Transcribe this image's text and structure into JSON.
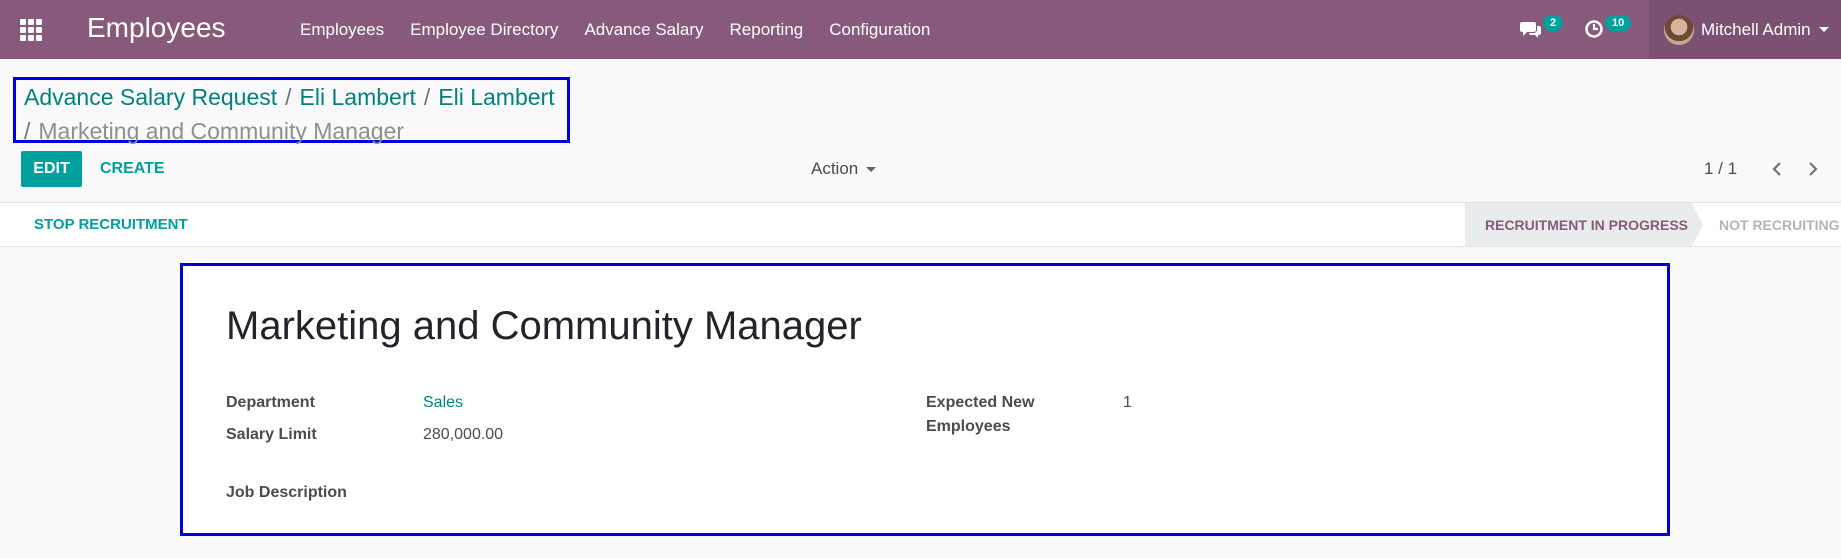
{
  "app": {
    "title": "Employees"
  },
  "menu": {
    "items": [
      "Employees",
      "Employee Directory",
      "Advance Salary",
      "Reporting",
      "Configuration"
    ]
  },
  "systray": {
    "messages_count": "2",
    "activities_count": "10",
    "user_name": "Mitchell Admin"
  },
  "breadcrumb": {
    "items": [
      "Advance Salary Request",
      "Eli Lambert",
      "Eli Lambert"
    ],
    "separator": "/",
    "active": "Marketing and Community Manager"
  },
  "controls": {
    "edit_label": "EDIT",
    "create_label": "CREATE",
    "action_label": "Action",
    "pager_value": "1 / 1"
  },
  "statusbar": {
    "stop_label": "STOP RECRUITMENT",
    "stages": [
      "RECRUITMENT IN PROGRESS",
      "NOT RECRUITING"
    ],
    "active_stage": "RECRUITMENT IN PROGRESS"
  },
  "form": {
    "job_title": "Marketing and Community Manager",
    "department_label": "Department",
    "department_value": "Sales",
    "salary_limit_label": "Salary Limit",
    "salary_limit_value": "280,000.00",
    "expected_label_line1": "Expected New",
    "expected_label_line2": "Employees",
    "expected_value": "1",
    "job_description_label": "Job Description"
  },
  "colors": {
    "brand": "#875a7b",
    "accent": "#00a09d",
    "highlight_box": "#0000dd"
  }
}
